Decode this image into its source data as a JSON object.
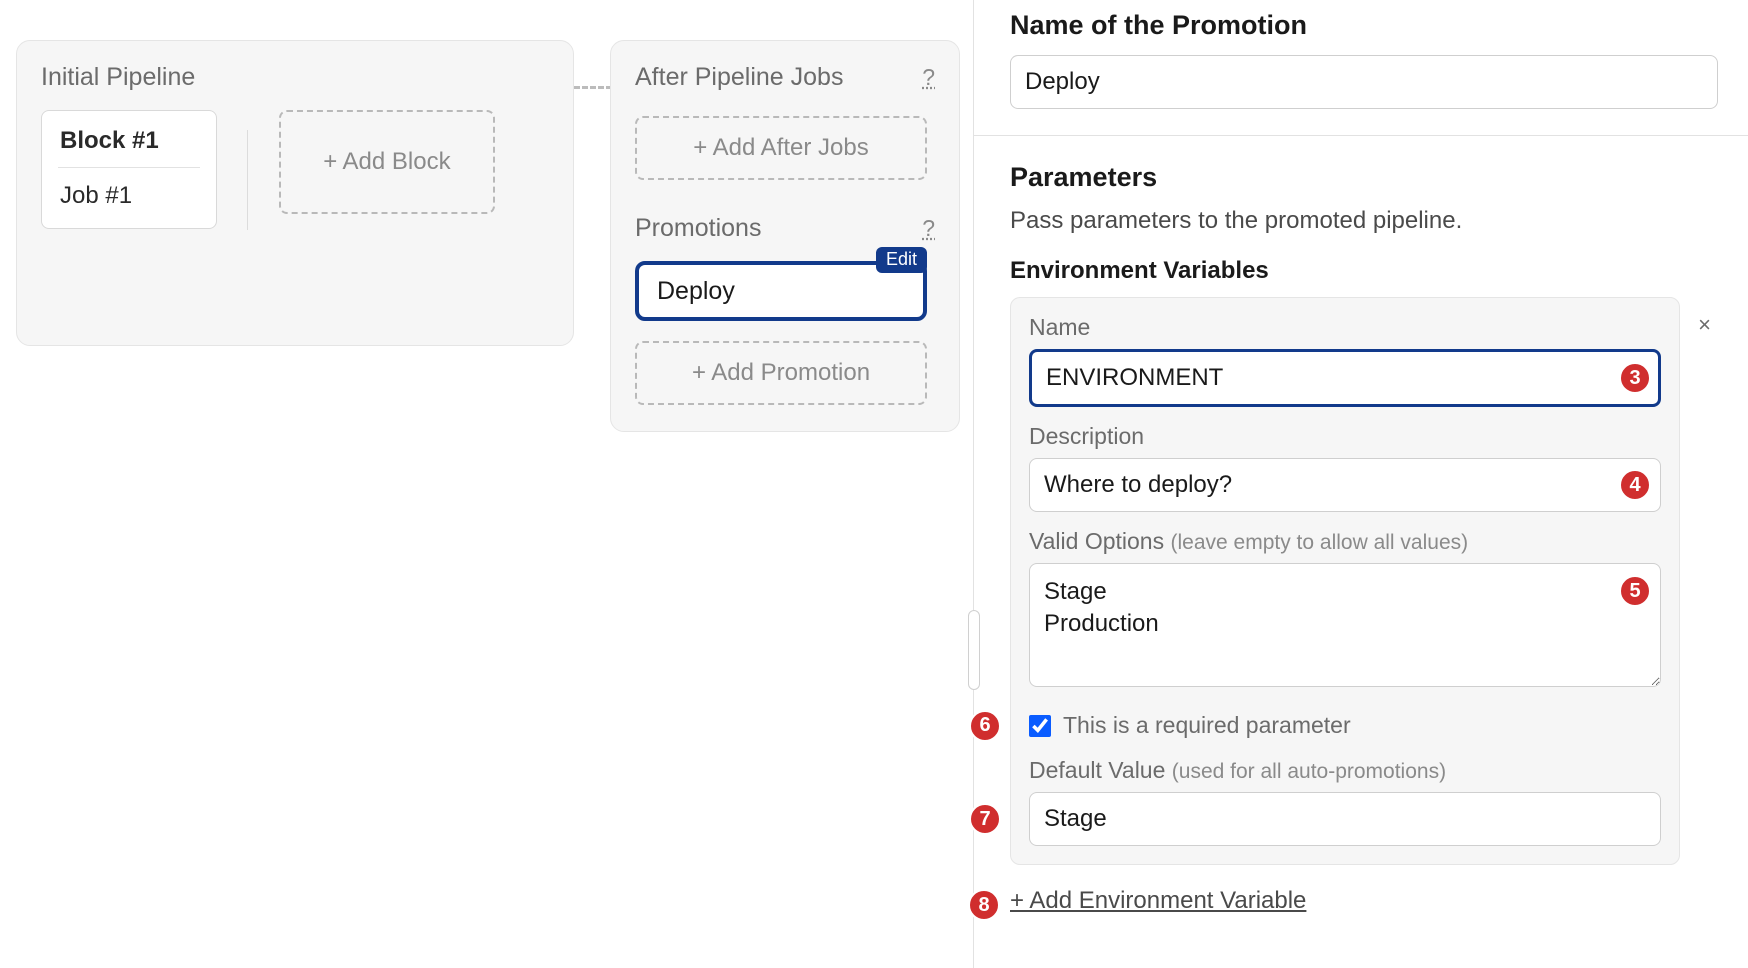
{
  "canvas": {
    "initial_title": "Initial Pipeline",
    "block_title": "Block #1",
    "job_title": "Job #1",
    "add_block_label": "+ Add Block",
    "after_title": "After Pipeline Jobs",
    "add_after_label": "+ Add After Jobs",
    "promotions_title": "Promotions",
    "promo_item_label": "Deploy",
    "promo_edit_label": "Edit",
    "add_promo_label": "+ Add Promotion",
    "help_q": "?"
  },
  "panel": {
    "name_heading": "Name of the Promotion",
    "name_value": "Deploy",
    "params_heading": "Parameters",
    "params_help": "Pass parameters to the promoted pipeline.",
    "env_heading": "Environment Variables",
    "env": {
      "name_label": "Name",
      "name_value": "ENVIRONMENT",
      "desc_label": "Description",
      "desc_value": "Where to deploy?",
      "valid_label": "Valid Options",
      "valid_hint": "(leave empty to allow all values)",
      "valid_value": "Stage\nProduction",
      "required_label": "This is a required parameter",
      "required_checked": true,
      "default_label": "Default Value",
      "default_hint": "(used for all auto-promotions)",
      "default_value": "Stage"
    },
    "add_env_label": "+ Add Environment Variable",
    "close_icon": "×"
  },
  "annotations": {
    "b3": "3",
    "b4": "4",
    "b5": "5",
    "b6": "6",
    "b7": "7",
    "b8": "8"
  }
}
